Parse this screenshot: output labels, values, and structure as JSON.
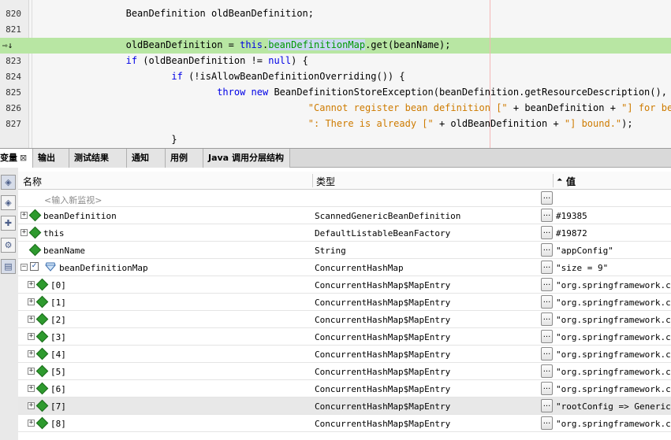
{
  "editor": {
    "lines": [
      {
        "num": "820",
        "code": [
          {
            "t": "                BeanDefinition oldBeanDefinition;",
            "c": ""
          }
        ]
      },
      {
        "num": "821",
        "code": []
      },
      {
        "num": "",
        "current": true,
        "arrow": "⇨↓",
        "code": [
          {
            "t": "                oldBeanDefinition = ",
            "c": ""
          },
          {
            "t": "this",
            "c": "kw"
          },
          {
            "t": ".",
            "c": ""
          },
          {
            "t": "beanDefinitionMap",
            "c": "fld"
          },
          {
            "t": ".get(beanName);",
            "c": ""
          }
        ]
      },
      {
        "num": "823",
        "code": [
          {
            "t": "                ",
            "c": ""
          },
          {
            "t": "if",
            "c": "kw"
          },
          {
            "t": " (oldBeanDefinition != ",
            "c": ""
          },
          {
            "t": "null",
            "c": "kw"
          },
          {
            "t": ") {",
            "c": ""
          }
        ]
      },
      {
        "num": "824",
        "code": [
          {
            "t": "                        ",
            "c": ""
          },
          {
            "t": "if",
            "c": "kw"
          },
          {
            "t": " (!isAllowBeanDefinitionOverriding()) {",
            "c": ""
          }
        ]
      },
      {
        "num": "825",
        "code": [
          {
            "t": "                                ",
            "c": ""
          },
          {
            "t": "throw",
            "c": "kw"
          },
          {
            "t": " ",
            "c": ""
          },
          {
            "t": "new",
            "c": "kw"
          },
          {
            "t": " BeanDefinitionStoreException(beanDefinition.getResourceDescription(), b",
            "c": ""
          }
        ]
      },
      {
        "num": "826",
        "code": [
          {
            "t": "                                                ",
            "c": ""
          },
          {
            "t": "\"Cannot register bean definition [\"",
            "c": "str"
          },
          {
            "t": " + beanDefinition + ",
            "c": ""
          },
          {
            "t": "\"] for bea",
            "c": "str"
          }
        ]
      },
      {
        "num": "827",
        "code": [
          {
            "t": "                                                ",
            "c": ""
          },
          {
            "t": "\": There is already [\"",
            "c": "str"
          },
          {
            "t": " + oldBeanDefinition + ",
            "c": ""
          },
          {
            "t": "\"] bound.\"",
            "c": "str"
          },
          {
            "t": ");",
            "c": ""
          }
        ]
      },
      {
        "num": "",
        "code": [
          {
            "t": "                        }",
            "c": ""
          }
        ]
      }
    ]
  },
  "tabs": [
    {
      "label": "变量",
      "close": "⊠",
      "active": true
    },
    {
      "label": "输出"
    },
    {
      "label": "测试结果"
    },
    {
      "label": "通知"
    },
    {
      "label": "用例"
    },
    {
      "label": "Java 调用分层结构"
    }
  ],
  "tools": [
    "watch-icon",
    "watch-icon",
    "add-watch-icon",
    "debug-settings-icon",
    "layout-icon"
  ],
  "table": {
    "columns": {
      "name": "名称",
      "type": "类型",
      "value": "值",
      "value_sort": "⏶"
    },
    "placeholder": "<输入新监视>",
    "ellipsis": "...",
    "rows": [
      {
        "name": "beanDefinition",
        "type": "ScannedGenericBeanDefinition",
        "value": "#19385",
        "expander": "+",
        "icon": "diamond",
        "level": 0
      },
      {
        "name": "this",
        "type": "DefaultListableBeanFactory",
        "value": "#19872",
        "expander": "+",
        "icon": "diamond",
        "level": 0
      },
      {
        "name": "beanName",
        "type": "String",
        "value": "\"appConfig\"",
        "expander": "",
        "icon": "diamond",
        "level": 0
      },
      {
        "name": "beanDefinitionMap",
        "type": "ConcurrentHashMap",
        "value": "\"size = 9\"",
        "expander": "−",
        "icon": "check-gem",
        "level": 0
      },
      {
        "name": "[0]",
        "type": "ConcurrentHashMap$MapEntry",
        "value": "\"org.springframework.cont",
        "expander": "+",
        "icon": "diamond",
        "level": 1
      },
      {
        "name": "[1]",
        "type": "ConcurrentHashMap$MapEntry",
        "value": "\"org.springframework.cont",
        "expander": "+",
        "icon": "diamond",
        "level": 1
      },
      {
        "name": "[2]",
        "type": "ConcurrentHashMap$MapEntry",
        "value": "\"org.springframework.cont",
        "expander": "+",
        "icon": "diamond",
        "level": 1
      },
      {
        "name": "[3]",
        "type": "ConcurrentHashMap$MapEntry",
        "value": "\"org.springframework.cont",
        "expander": "+",
        "icon": "diamond",
        "level": 1
      },
      {
        "name": "[4]",
        "type": "ConcurrentHashMap$MapEntry",
        "value": "\"org.springframework.cont",
        "expander": "+",
        "icon": "diamond",
        "level": 1
      },
      {
        "name": "[5]",
        "type": "ConcurrentHashMap$MapEntry",
        "value": "\"org.springframework.cont",
        "expander": "+",
        "icon": "diamond",
        "level": 1
      },
      {
        "name": "[6]",
        "type": "ConcurrentHashMap$MapEntry",
        "value": "\"org.springframework.cont",
        "expander": "+",
        "icon": "diamond",
        "level": 1
      },
      {
        "name": "[7]",
        "type": "ConcurrentHashMap$MapEntry",
        "value": "\"rootConfig => Generic be",
        "expander": "+",
        "icon": "diamond",
        "level": 1,
        "selected": true
      },
      {
        "name": "[8]",
        "type": "ConcurrentHashMap$MapEntry",
        "value": "\"org.springframework.cont",
        "expander": "+",
        "icon": "diamond",
        "level": 1
      }
    ]
  }
}
